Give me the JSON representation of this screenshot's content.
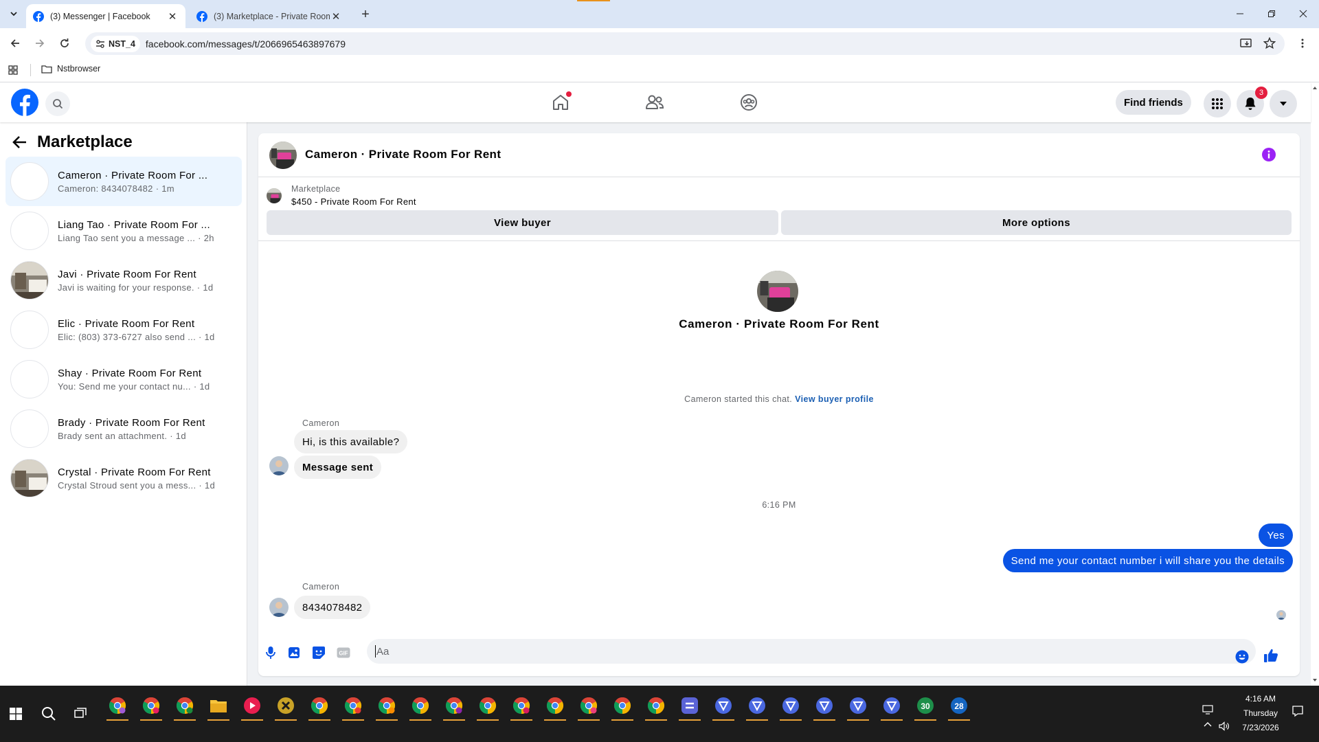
{
  "browser": {
    "tabs": [
      {
        "title": "(3) Messenger | Facebook",
        "active": true
      },
      {
        "title": "(3) Marketplace - Private Room",
        "active": false
      }
    ],
    "profile_chip": "NST_4",
    "url": "facebook.com/messages/t/2066965463897679",
    "bookmarks": [
      {
        "label": "Nstbrowser"
      }
    ]
  },
  "header": {
    "find_friends": "Find friends",
    "notification_count": "3",
    "colors": {
      "brand": "#0866ff",
      "badge": "#e41e3f"
    }
  },
  "sidebar": {
    "title": "Marketplace",
    "conversations": [
      {
        "name": "Cameron · Private Room For ...",
        "preview": "Cameron: 8434078482",
        "time": "· 1m",
        "selected": true,
        "avatar": "blank"
      },
      {
        "name": "Liang Tao · Private Room For ...",
        "preview": "Liang Tao sent you a message ...",
        "time": "· 2h",
        "selected": false,
        "avatar": "blank"
      },
      {
        "name": "Javi · Private Room For Rent",
        "preview": "Javi is waiting for your response.",
        "time": "· 1d",
        "selected": false,
        "avatar": "room-photo"
      },
      {
        "name": "Elic · Private Room For Rent",
        "preview": "Elic: (803) 373-6727 also send ...",
        "time": "· 1d",
        "selected": false,
        "avatar": "blank"
      },
      {
        "name": "Shay · Private Room For Rent",
        "preview": "You: Send me your contact nu...",
        "time": "· 1d",
        "selected": false,
        "avatar": "blank"
      },
      {
        "name": "Brady · Private Room For Rent",
        "preview": "Brady sent an attachment.",
        "time": "· 1d",
        "selected": false,
        "avatar": "blank"
      },
      {
        "name": "Crystal · Private Room For Rent",
        "preview": "Crystal Stroud sent you a mess...",
        "time": "· 1d",
        "selected": false,
        "avatar": "room-photo"
      }
    ]
  },
  "chat": {
    "title": "Cameron · Private Room For Rent",
    "marketplace_label": "Marketplace",
    "listing": "$450 - Private Room For Rent",
    "view_buyer": "View buyer",
    "more_options": "More options",
    "intro_name": "Cameron · Private Room For Rent",
    "started_text": "Cameron started this chat.",
    "view_buyer_profile": "View buyer profile",
    "messages_group1": {
      "sender": "Cameron",
      "msg1": "Hi, is this available?",
      "msg2": "Message sent"
    },
    "timestamp": "6:16 PM",
    "outgoing": {
      "msg1": "Yes",
      "msg2": "Send me your contact number i will share you the details"
    },
    "messages_group2": {
      "sender": "Cameron",
      "msg1": "8434078482"
    },
    "composer_placeholder": "Aa",
    "colors": {
      "outgoing_bubble": "#0a53e4",
      "incoming_bubble": "#f0f0f0",
      "accent": "#9b22f5"
    }
  },
  "taskbar": {
    "time": "4:16 AM",
    "day": "Thursday",
    "date": "7/23/2026",
    "badges": {
      "app1": "30",
      "app2": "28"
    }
  }
}
